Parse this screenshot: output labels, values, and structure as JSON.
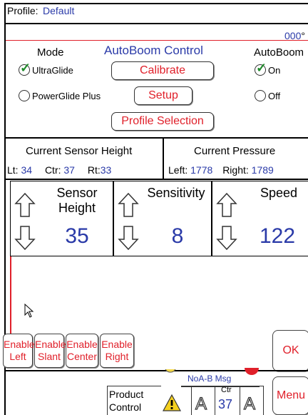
{
  "profile": {
    "label": "Profile:",
    "value": "Default"
  },
  "heading": {
    "value": "000",
    "unit": "°"
  },
  "autoboom": {
    "title": "AutoBoom Control",
    "mode_label": "Mode",
    "autoboom_label": "AutoBoom",
    "options": {
      "ultraglide": "UltraGlide",
      "powerglide": "PowerGlide Plus",
      "on": "On",
      "off": "Off"
    },
    "buttons": {
      "calibrate": "Calibrate",
      "setup": "Setup",
      "profile_selection": "Profile Selection"
    }
  },
  "sensor_height": {
    "title": "Current Sensor Height",
    "lt_label": "Lt:",
    "lt_value": "34",
    "ctr_label": "Ctr:",
    "ctr_value": "37",
    "rt_label": "Rt:",
    "rt_value": "33"
  },
  "pressure": {
    "title": "Current Pressure",
    "left_label": "Left:",
    "left_value": "1778",
    "right_label": "Right:",
    "right_value": "1789"
  },
  "controls": [
    {
      "label_line1": "Sensor",
      "label_line2": "Height",
      "value": "35"
    },
    {
      "label_line1": "Sensitivity",
      "label_line2": "",
      "value": "8"
    },
    {
      "label_line1": "Speed",
      "label_line2": "",
      "value": "122"
    }
  ],
  "enable_buttons": [
    {
      "line1": "Enable",
      "line2": "Left"
    },
    {
      "line1": "Enable",
      "line2": "Slant"
    },
    {
      "line1": "Enable",
      "line2": "Center"
    },
    {
      "line1": "Enable",
      "line2": "Right"
    }
  ],
  "ok_label": "OK",
  "bottom": {
    "noa_msg": "NoA-B Msg",
    "product_control_line1": "Product",
    "product_control_line2": "Control",
    "ctr_label": "Ctr",
    "ctr_value": "37",
    "menu_label": "Menu",
    "glyph_a": "A"
  },
  "colors": {
    "accent_red": "#e0202a",
    "value_blue": "#2a3aa8",
    "check_green": "#1e8a2a"
  }
}
